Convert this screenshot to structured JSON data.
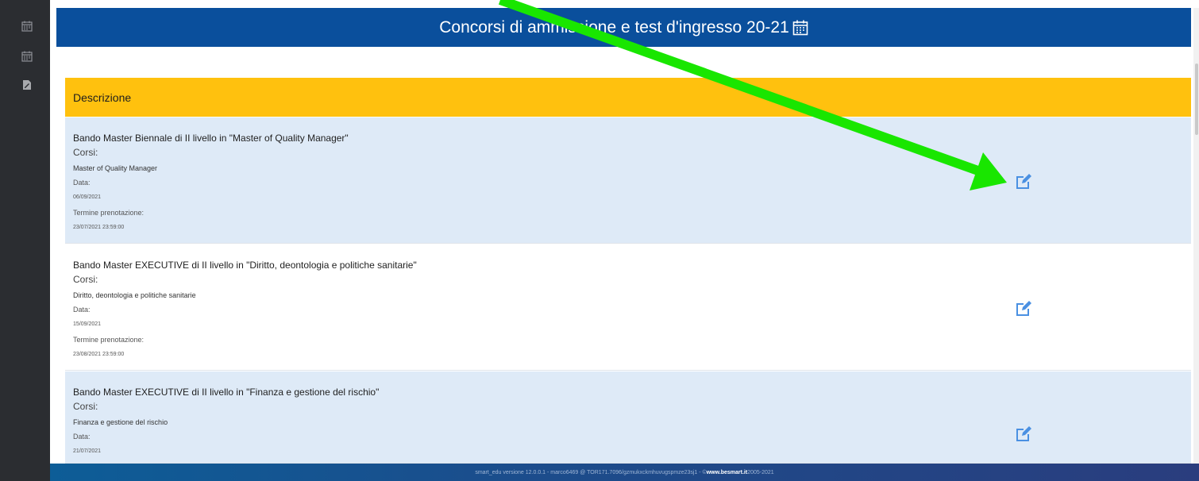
{
  "header": {
    "title": "Concorsi di ammissione e test d'ingresso 20-21"
  },
  "table": {
    "column": "Descrizione",
    "rows": [
      {
        "title": "Bando Master Biennale di II livello in \"Master of Quality Manager\"",
        "corsi_label": "Corsi:",
        "corsi_value": "Master of Quality Manager",
        "data_label": "Data:",
        "data_value": "06/09/2021",
        "termine_label": "Termine prenotazione:",
        "termine_value": "23/07/2021 23:59:00"
      },
      {
        "title": "Bando Master EXECUTIVE di II livello in \"Diritto, deontologia e politiche sanitarie\"",
        "corsi_label": "Corsi:",
        "corsi_value": "Diritto, deontologia e politiche sanitarie",
        "data_label": "Data:",
        "data_value": "15/09/2021",
        "termine_label": "Termine prenotazione:",
        "termine_value": "23/08/2021 23:59:00"
      },
      {
        "title": "Bando Master EXECUTIVE di II livello in \"Finanza e gestione del rischio\"",
        "corsi_label": "Corsi:",
        "corsi_value": "Finanza e gestione del rischio",
        "data_label": "Data:",
        "data_value": "21/07/2021"
      }
    ]
  },
  "footer": {
    "text": "smart_edu versione 12.0.0.1 - marco6469 @ TOR171.7096/gzmukxckmhuvugspmze23sj1 - © ",
    "link": "www.besmart.it",
    "years": " 2005-2021"
  },
  "icons": {
    "sidebar": [
      "calendar-icon",
      "calendar-icon",
      "file-pdf-icon"
    ],
    "header": "calendar-icon",
    "row_action": "edit-icon"
  },
  "colors": {
    "header_bg": "#0a4f9c",
    "table_head_bg": "#ffc10e",
    "row_alt_bg": "#deeaf7",
    "sidebar_bg": "#2b2d31",
    "edit_icon": "#4a90e2",
    "arrow": "#19e600"
  }
}
